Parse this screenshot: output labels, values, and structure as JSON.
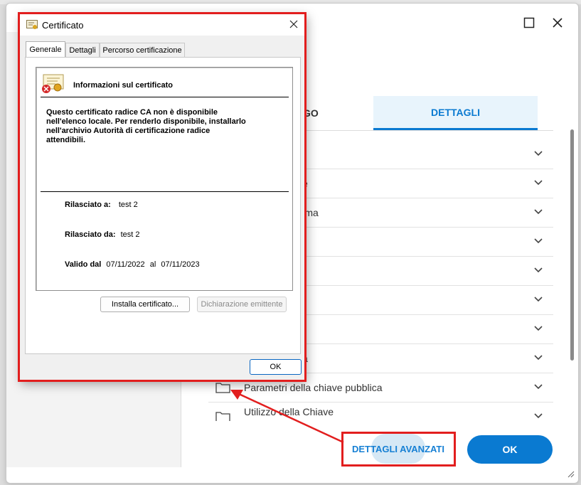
{
  "cert_dialog": {
    "title": "Certificato",
    "tabs": [
      "Generale",
      "Dettagli",
      "Percorso certificazione"
    ],
    "info_heading": "Informazioni sul certificato",
    "message_lines": [
      "Questo certificato radice CA non è disponibile",
      "nell'elenco locale. Per renderlo disponibile, installarlo",
      "nell'archivio Autorità di certificazione radice",
      "attendibili."
    ],
    "issued_to_label": "Rilasciato a:",
    "issued_to_value": "test 2",
    "issued_by_label": "Rilasciato da:",
    "issued_by_value": "test 2",
    "valid_label": "Valido dal",
    "valid_from": "07/11/2022",
    "valid_sep": "al",
    "valid_to": "07/11/2023",
    "install_button": "Installa certificato...",
    "issuer_statement_button": "Dichiarazione emittente",
    "ok_button": "OK"
  },
  "background": {
    "tabs": {
      "partial": "GO",
      "active": "DETTAGLI"
    },
    "rows": [
      {
        "label": "",
        "folder": false
      },
      {
        "label": "e",
        "folder": false
      },
      {
        "label": "a firma",
        "folder": false
      },
      {
        "label": "",
        "folder": false
      },
      {
        "label": "",
        "folder": false
      },
      {
        "label": "",
        "folder": false
      },
      {
        "label": "",
        "folder": false
      },
      {
        "label": "a",
        "folder": false
      },
      {
        "label": "Parametri della chiave pubblica",
        "folder": true
      },
      {
        "label": "Utilizzo della Chiave",
        "folder": true
      }
    ],
    "advanced_button": "DETTAGLI AVANZATI",
    "ok_button": "OK"
  },
  "colors": {
    "accent": "#0a7ad1",
    "highlight": "#e21e1e"
  }
}
